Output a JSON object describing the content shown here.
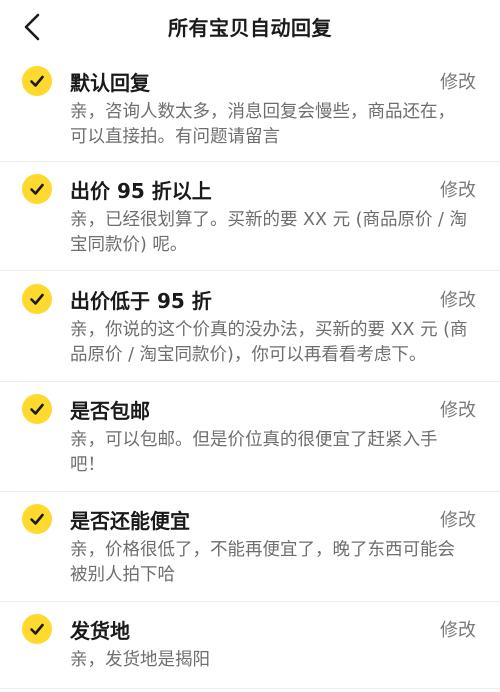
{
  "header": {
    "title": "所有宝贝自动回复",
    "back_icon": "chevron-left-icon"
  },
  "colors": {
    "check_bg": "#ffd92e",
    "check_mark": "#1a1a1a",
    "title_text": "#1a1a1a",
    "body_text": "#6e6e6e",
    "edit_text": "#7a7a7a",
    "divider": "#ececec"
  },
  "items": [
    {
      "title": "默认回复",
      "edit_label": "修改",
      "text": "亲，咨询人数太多，消息回复会慢些，商品还在，可以直接拍。有问题请留言",
      "checked": true
    },
    {
      "title": "出价 95 折以上",
      "edit_label": "修改",
      "text": "亲，已经很划算了。买新的要 XX 元 (商品原价 / 淘宝同款价) 呢。",
      "checked": true
    },
    {
      "title": "出价低于 95 折",
      "edit_label": "修改",
      "text": "亲，你说的这个价真的没办法，买新的要 XX 元 (商品原价 / 淘宝同款价)，你可以再看看考虑下。",
      "checked": true
    },
    {
      "title": "是否包邮",
      "edit_label": "修改",
      "text": "亲，可以包邮。但是价位真的很便宜了赶紧入手吧！",
      "checked": true
    },
    {
      "title": "是否还能便宜",
      "edit_label": "修改",
      "text": "亲，价格很低了，不能再便宜了，晚了东西可能会被别人拍下哈",
      "checked": true
    },
    {
      "title": "发货地",
      "edit_label": "修改",
      "text": "亲，发货地是揭阳",
      "checked": true
    }
  ]
}
